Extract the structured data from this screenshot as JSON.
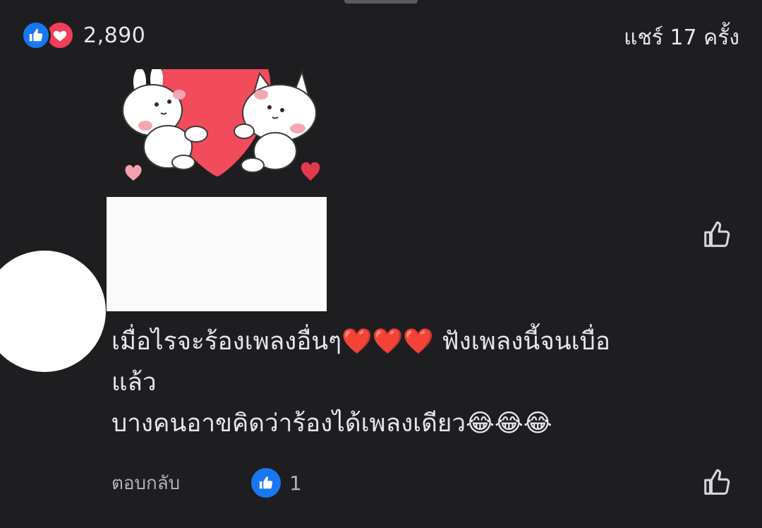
{
  "post": {
    "reactions": {
      "icons": [
        "like-icon",
        "love-icon"
      ],
      "count": "2,890"
    },
    "share_count": "แชร์ 17 ครั้ง"
  },
  "comment": {
    "lines": [
      "เมื่อไรจะร้องเพลงอื่นๆ❤️❤️❤️ ฟังเพลงนี้จนเบื่อ",
      "แล้ว",
      "บางคนอาขคิดว่าร้องได้เพลงเดียว😂😂😂"
    ],
    "reply_label": "ตอบกลับ",
    "like_count": "1"
  },
  "colors": {
    "background": "#1e1e20",
    "like_blue": "#1877f2",
    "love_red": "#f33e58",
    "text": "#e4e6eb",
    "muted": "#b0b3b8"
  }
}
